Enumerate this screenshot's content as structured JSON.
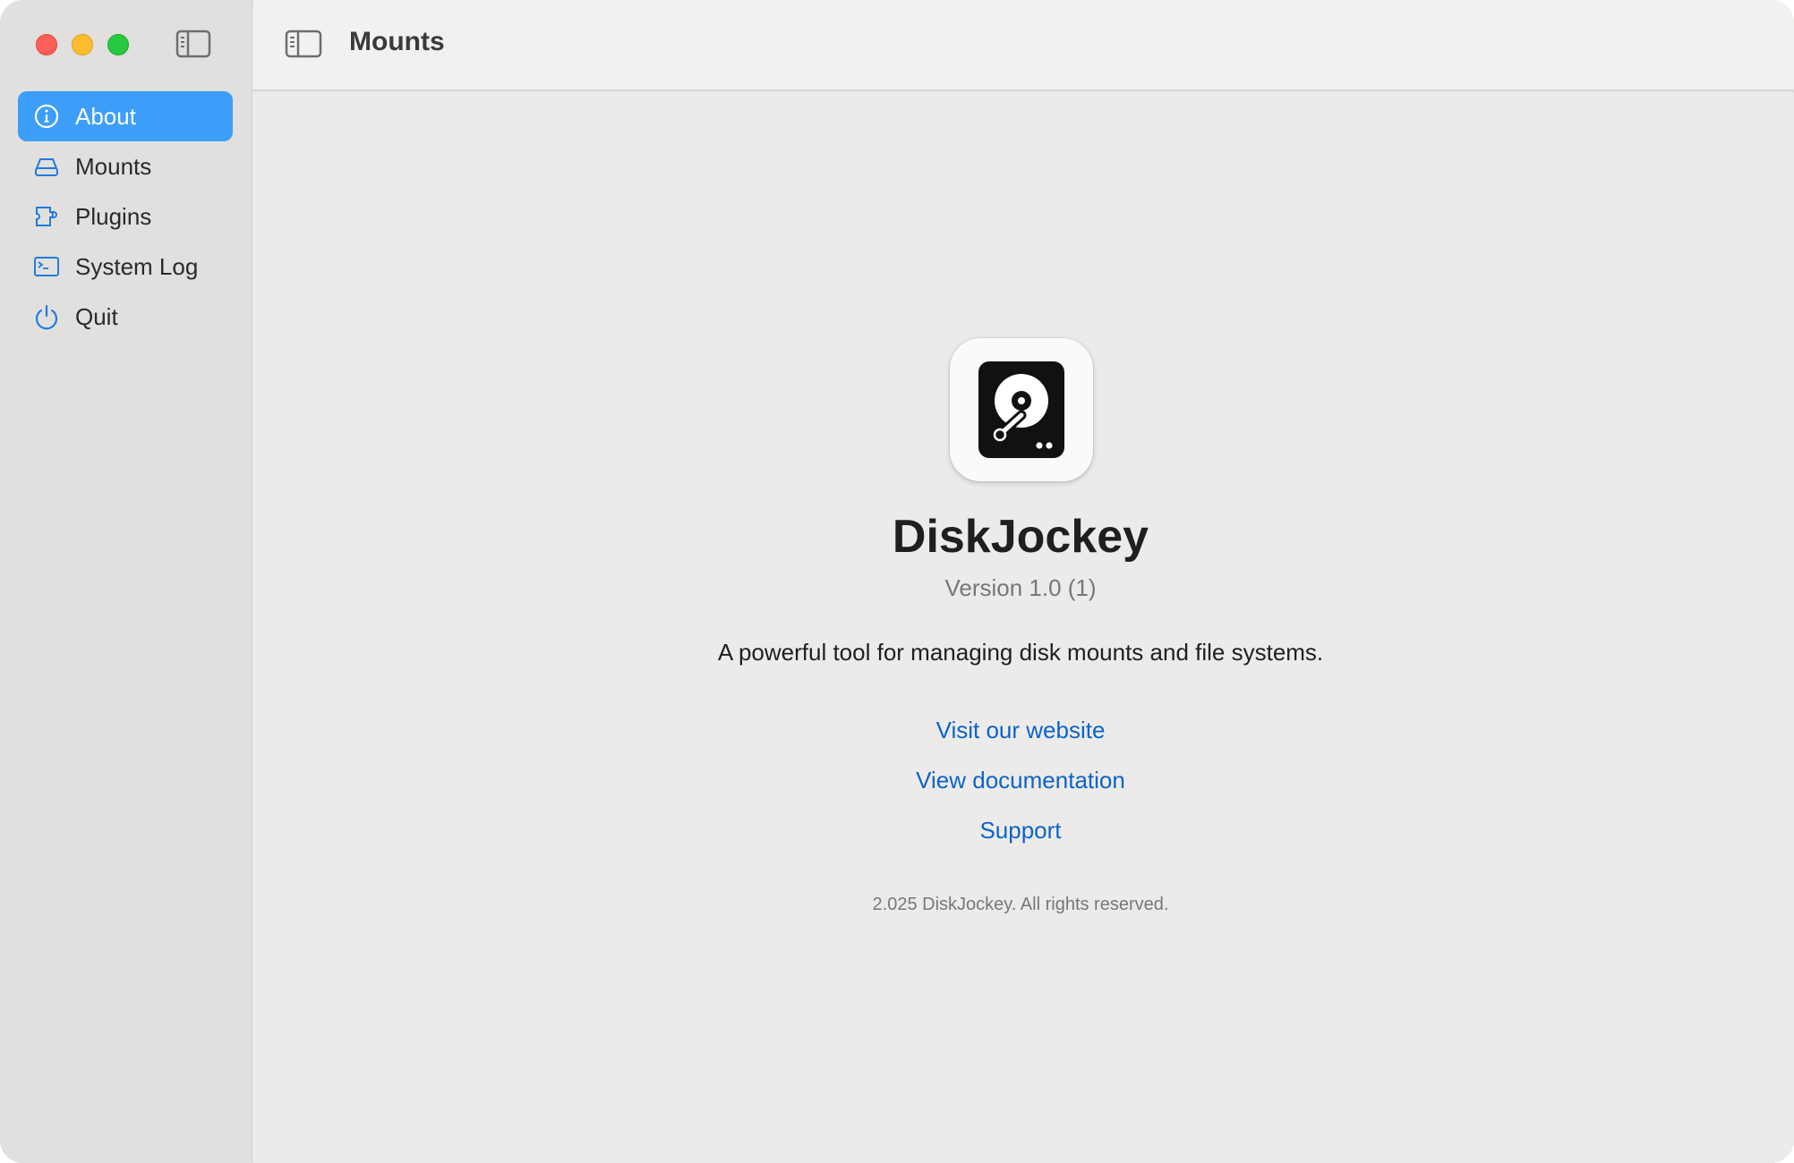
{
  "window": {
    "traffic_lights": [
      "close",
      "minimize",
      "zoom"
    ]
  },
  "sidebar": {
    "toggle_icon": "sidebar-toggle-icon",
    "items": [
      {
        "label": "About",
        "icon": "info-circle-icon",
        "active": true
      },
      {
        "label": "Mounts",
        "icon": "drive-icon",
        "active": false
      },
      {
        "label": "Plugins",
        "icon": "plugin-icon",
        "active": false
      },
      {
        "label": "System Log",
        "icon": "terminal-icon",
        "active": false
      },
      {
        "label": "Quit",
        "icon": "power-icon",
        "active": false
      }
    ]
  },
  "toolbar": {
    "title": "Mounts",
    "toggle_icon": "sidebar-toggle-icon"
  },
  "about": {
    "app_icon": "hard-drive-icon",
    "app_name": "DiskJockey",
    "version": "Version 1.0 (1)",
    "description": "A powerful tool for managing disk mounts and file systems.",
    "links": {
      "website": "Visit our website",
      "docs": "View documentation",
      "support": "Support"
    },
    "copyright": "2.025 DiskJockey. All rights reserved."
  },
  "colors": {
    "accent": "#3c9ef8",
    "link": "#0b63ce",
    "sidebar_bg": "#e1e0de",
    "content_bg": "#ecebe9"
  }
}
